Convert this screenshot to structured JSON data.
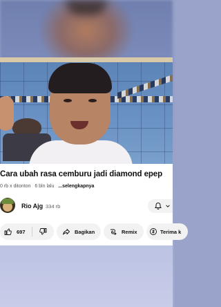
{
  "video": {
    "title": "Cara ubah rasa cemburu jadi diamond epep",
    "meta_views": "0 rb x ditonton",
    "meta_age": "6 bln lalu",
    "meta_more": "...selengkapnya"
  },
  "channel": {
    "name": "Rio Ajg",
    "subscribers": "334 rb"
  },
  "actions": {
    "like_count": "697",
    "share_label": "Bagikan",
    "remix_label": "Remix",
    "thanks_label": "Terima k"
  },
  "icons": {
    "like": "thumbs-up-icon",
    "dislike": "thumbs-down-icon",
    "share": "share-arrow-icon",
    "remix": "remix-icon",
    "thanks": "super-thanks-icon",
    "bell": "bell-icon",
    "chevron": "chevron-down-icon"
  },
  "colors": {
    "panel_bg": "#ffffff",
    "pill_bg": "#f2f2f2",
    "text_primary": "#0f0f0f",
    "text_secondary": "#606060"
  }
}
